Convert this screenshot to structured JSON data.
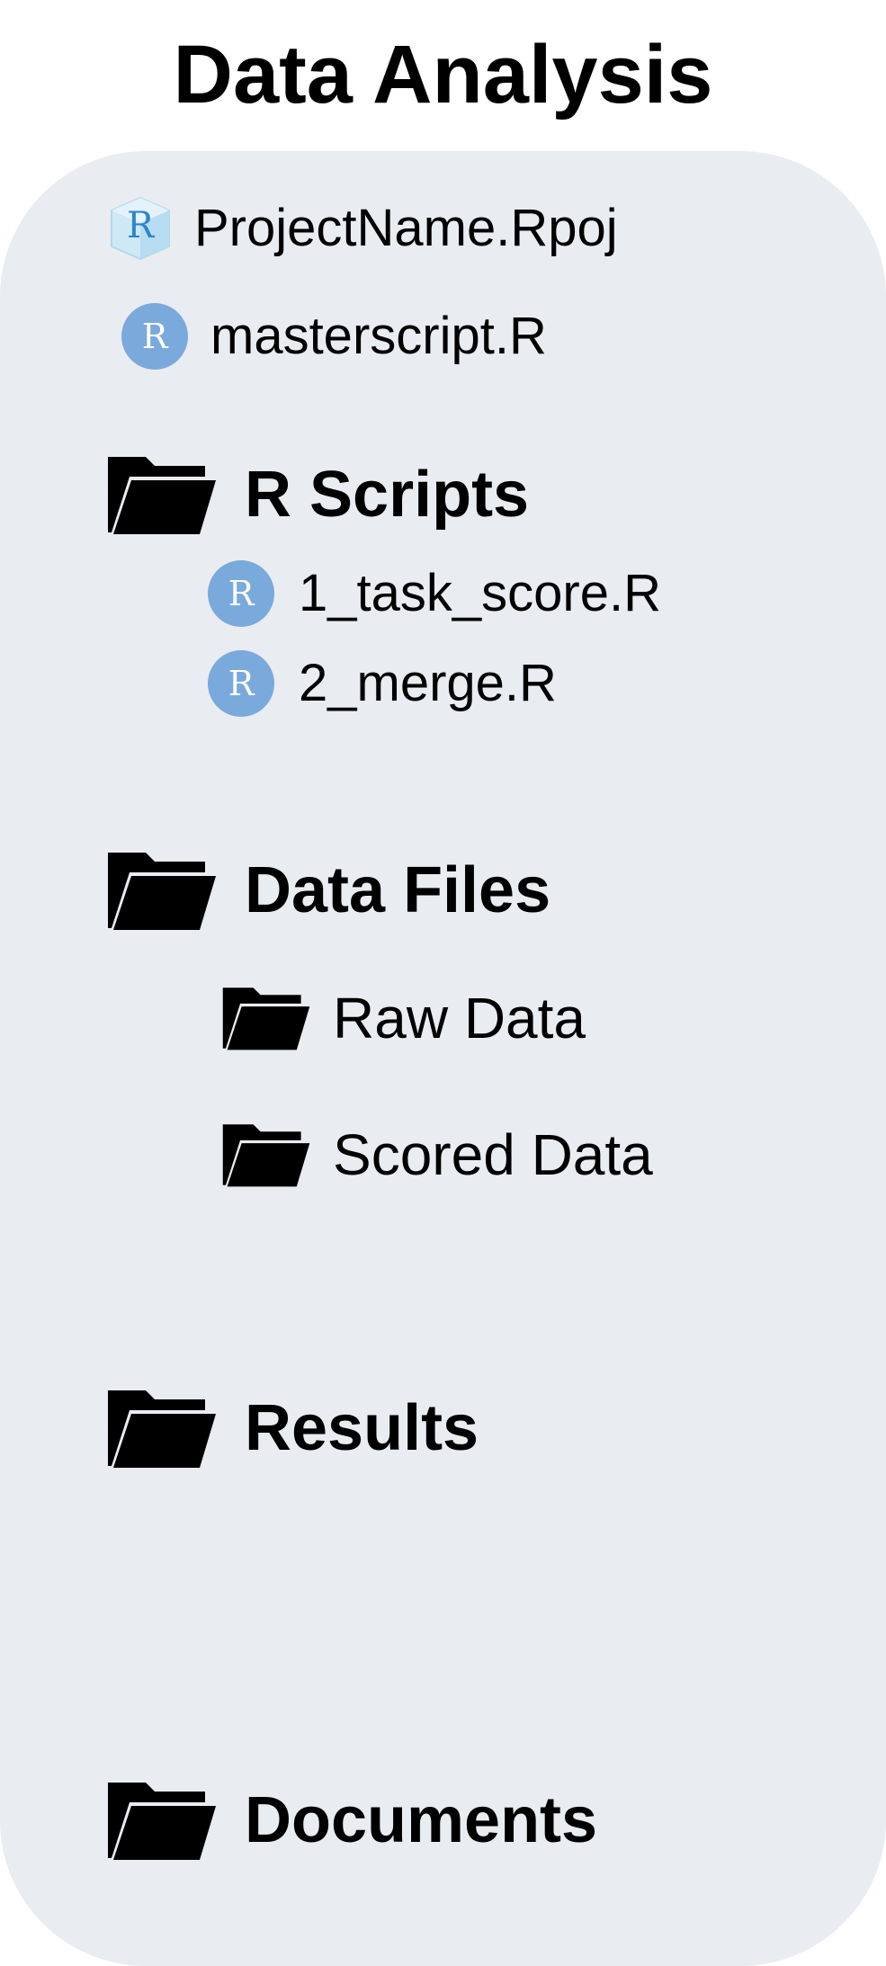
{
  "title": "Data Analysis",
  "colors": {
    "panel_background": "#e9ecf1",
    "r_circle": "#7aa9dc",
    "r_cube": "#bfe1f4",
    "folder": "#000000"
  },
  "root_files": [
    {
      "icon": "r-project-cube-icon",
      "label": "ProjectName.Rpoj"
    },
    {
      "icon": "r-file-icon",
      "label": "masterscript.R"
    }
  ],
  "folders": [
    {
      "icon": "folder-open-icon",
      "label": "R Scripts",
      "files": [
        {
          "icon": "r-file-icon",
          "label": "1_task_score.R"
        },
        {
          "icon": "r-file-icon",
          "label": "2_merge.R"
        }
      ]
    },
    {
      "icon": "folder-open-icon",
      "label": "Data Files",
      "subfolders": [
        {
          "icon": "folder-open-icon",
          "label": "Raw Data"
        },
        {
          "icon": "folder-open-icon",
          "label": "Scored Data"
        }
      ]
    },
    {
      "icon": "folder-open-icon",
      "label": "Results"
    },
    {
      "icon": "folder-open-icon",
      "label": "Documents"
    }
  ]
}
